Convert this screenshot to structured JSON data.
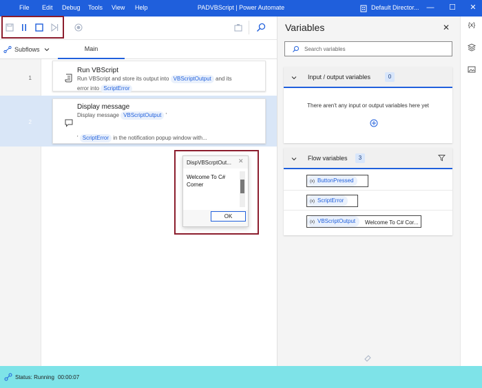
{
  "window": {
    "title": "PADVBScript | Power Automate",
    "environment": "Default Director...",
    "menu": [
      "File",
      "Edit",
      "Debug",
      "Tools",
      "View",
      "Help"
    ]
  },
  "subflows": {
    "label": "Subflows",
    "main_tab": "Main"
  },
  "actions": [
    {
      "number": "1",
      "title": "Run VBScript",
      "desc_pre": "Run VBScript and store its output into",
      "var1": "VBScriptOutput",
      "desc_mid": "and its",
      "desc_pre2": "error into",
      "var2": "ScriptError"
    },
    {
      "number": "2",
      "title": "Display message",
      "desc_pre": "Display message",
      "var1": "VBScriptOutput",
      "quote": "'",
      "quote2": "'",
      "var2": "ScriptError",
      "desc_post": "in the notification popup window with..."
    }
  ],
  "dialog": {
    "title": "DispVBScrptOut...",
    "message": "Welcome To C# Corner",
    "ok": "OK"
  },
  "variables": {
    "heading": "Variables",
    "search_placeholder": "Search variables",
    "io_section": {
      "title": "Input / output variables",
      "count": "0",
      "empty_text": "There aren't any input or output variables here yet"
    },
    "flow_section": {
      "title": "Flow variables",
      "count": "3",
      "items": [
        {
          "name": "ButtonPressed",
          "value": ""
        },
        {
          "name": "ScriptError",
          "value": ""
        },
        {
          "name": "VBScriptOutput",
          "value": "Welcome To C# Cor..."
        }
      ]
    },
    "var_marker": "(x)"
  },
  "side_icons": {
    "variables_label": "{x}"
  },
  "status": {
    "text": "Status: Running",
    "time": "00:00:07"
  },
  "colors": {
    "accent": "#1f5fdc",
    "status_bar": "#7ee3e8",
    "highlight_box": "#8b1c2c",
    "selected_row": "#d9e6f7"
  }
}
